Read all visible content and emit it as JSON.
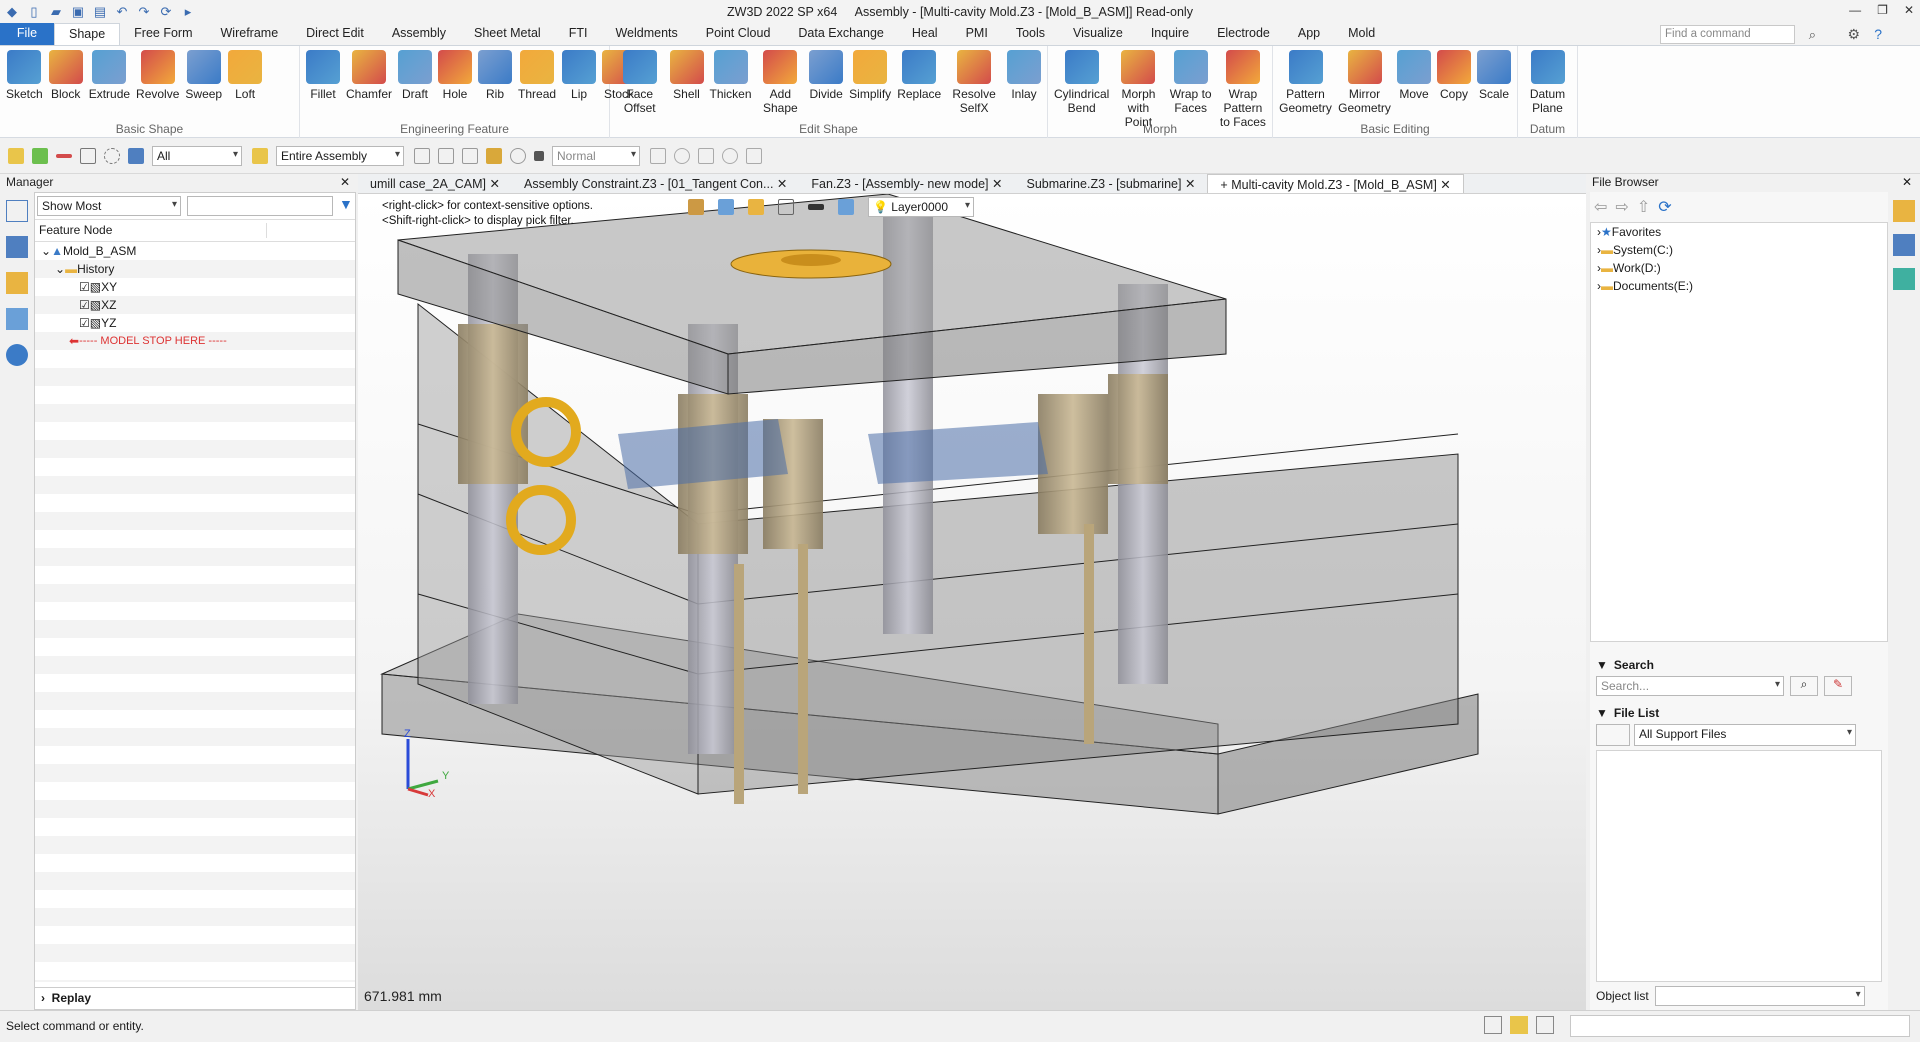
{
  "app": {
    "title": "ZW3D 2022 SP x64",
    "doc_title": "Assembly - [Multi-cavity Mold.Z3 - [Mold_B_ASM]] Read-only"
  },
  "menu": {
    "items": [
      "File",
      "Shape",
      "Free Form",
      "Wireframe",
      "Direct Edit",
      "Assembly",
      "Sheet Metal",
      "FTI",
      "Weldments",
      "Point Cloud",
      "Data Exchange",
      "Heal",
      "PMI",
      "Tools",
      "Visualize",
      "Inquire",
      "Electrode",
      "App",
      "Mold"
    ],
    "active": "Shape"
  },
  "command_search": {
    "placeholder": "Find a command"
  },
  "ribbon": {
    "basic_shape": {
      "label": "Basic Shape",
      "buttons": [
        "Sketch",
        "Block",
        "Extrude",
        "Revolve",
        "Sweep",
        "Loft"
      ]
    },
    "engineering_feature": {
      "label": "Engineering Feature",
      "buttons": [
        "Fillet",
        "Chamfer",
        "Draft",
        "Hole",
        "Rib",
        "Thread",
        "Lip",
        "Stock"
      ]
    },
    "edit_shape": {
      "label": "Edit Shape",
      "buttons": [
        "Face Offset",
        "Shell",
        "Thicken",
        "Add Shape",
        "Divide",
        "Simplify",
        "Replace",
        "Resolve SelfX",
        "Inlay"
      ]
    },
    "morph": {
      "label": "Morph",
      "buttons": [
        "Cylindrical Bend",
        "Morph with Point",
        "Wrap to Faces",
        "Wrap Pattern to Faces"
      ]
    },
    "basic_editing": {
      "label": "Basic Editing",
      "buttons": [
        "Pattern Geometry",
        "Mirror Geometry",
        "Move",
        "Copy",
        "Scale"
      ]
    },
    "datum": {
      "label": "Datum",
      "buttons": [
        "Datum Plane"
      ]
    }
  },
  "toolbar": {
    "filter_value": "All",
    "scope_value": "Entire Assembly",
    "render_mode": "Normal"
  },
  "manager": {
    "title": "Manager",
    "filter_value": "Show Most",
    "column_header": "Feature Node",
    "tree": [
      {
        "label": "Mold_B_ASM",
        "level": 0
      },
      {
        "label": "History",
        "level": 1
      },
      {
        "label": "XY",
        "level": 2
      },
      {
        "label": "XZ",
        "level": 2
      },
      {
        "label": "YZ",
        "level": 2
      },
      {
        "label": "----- MODEL STOP HERE -----",
        "level": 2
      }
    ],
    "replay_label": "Replay"
  },
  "tabs": [
    "umill case_2A_CAM]",
    "Assembly Constraint.Z3 - [01_Tangent Con...",
    "Fan.Z3 - [Assembly- new mode]",
    "Submarine.Z3 - [submarine]",
    "Multi-cavity Mold.Z3 - [Mold_B_ASM]"
  ],
  "viewport": {
    "hint_line1": "<right-click> for context-sensitive options.",
    "hint_line2": "<Shift-right-click> to display pick filter.",
    "layer": "Layer0000",
    "scale_text": "671.981 mm",
    "axes": {
      "z": "Z",
      "y": "Y",
      "x": "X"
    }
  },
  "file_browser": {
    "title": "File Browser",
    "items": [
      "Favorites",
      "System(C:)",
      "Work(D:)",
      "Documents(E:)"
    ],
    "search_title": "Search",
    "search_placeholder": "Search...",
    "file_list_title": "File List",
    "file_filter": "All Support Files",
    "object_list_label": "Object list"
  },
  "status": {
    "text": "Select command or entity."
  }
}
